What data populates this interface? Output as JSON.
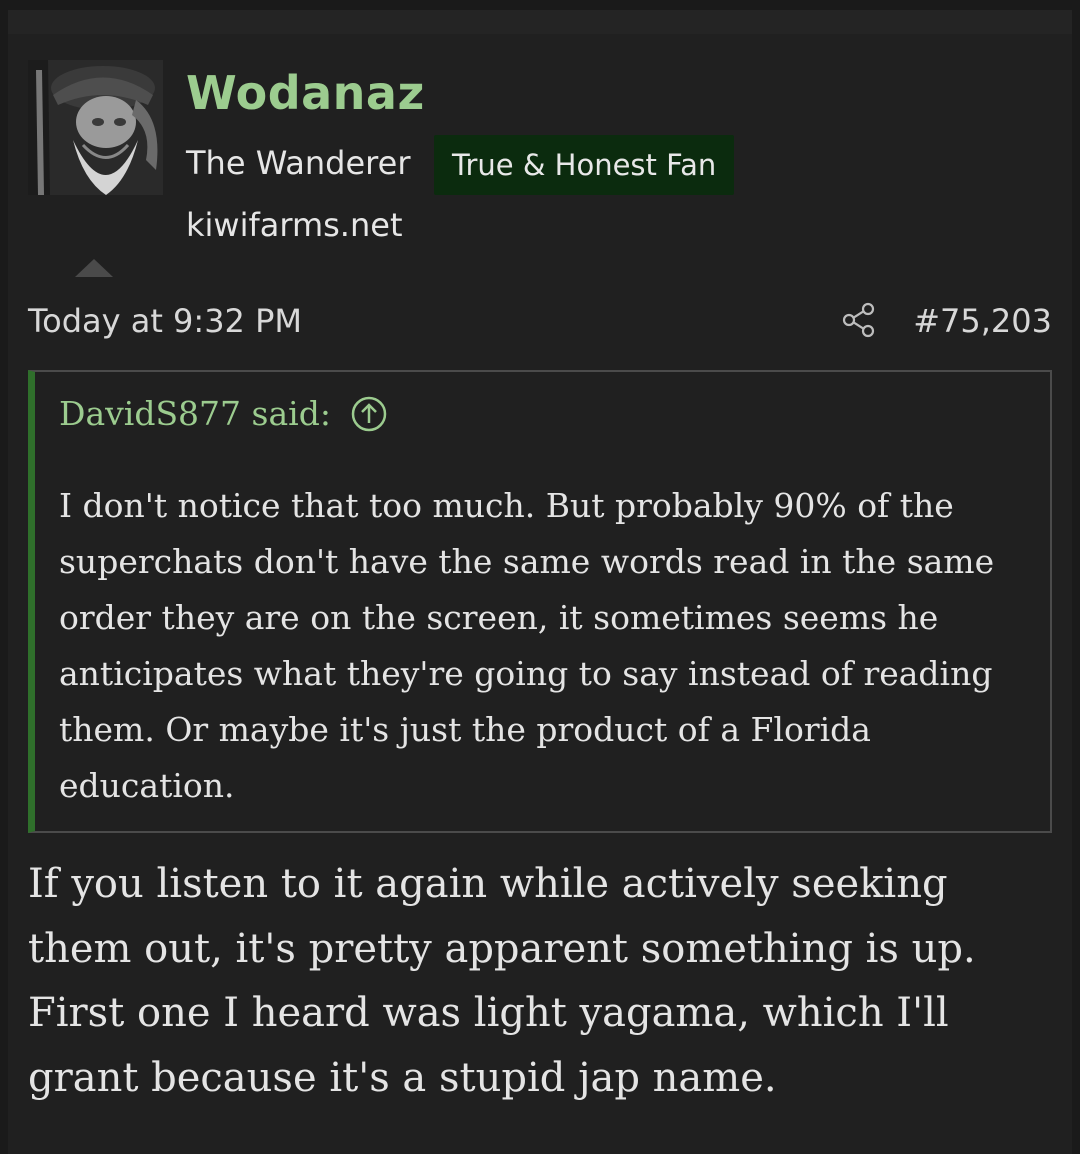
{
  "author": {
    "username": "Wodanaz",
    "user_title": "The Wanderer",
    "banner": "True & Honest Fan",
    "site": "kiwifarms.net"
  },
  "post": {
    "date": "Today at 9:32 PM",
    "number": "#75,203",
    "share_icon": "share-icon"
  },
  "quote": {
    "author_line": "DavidS877 said:",
    "jump_icon": "arrow-up-circle-icon",
    "text": "I don't notice that too much. But probably 90% of the superchats don't have the same words read in the same order they are on the screen, it sometimes seems he anticipates what they're going to say instead of reading them. Or maybe it's just the product of a Florida education."
  },
  "body": {
    "text": "If you listen to it again while actively seeking them out, it's pretty apparent something is up. First one I heard was light yagama, which I'll grant because it's a stupid jap name."
  },
  "colors": {
    "username": "#9ccc8f",
    "banner_bg": "#0b2b0e",
    "quote_bar": "#2f6f2b",
    "page_bg": "#202020"
  }
}
